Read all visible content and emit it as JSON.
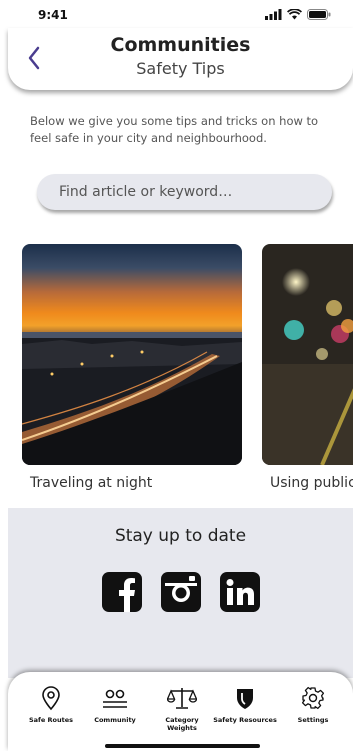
{
  "status": {
    "time": "9:41"
  },
  "header": {
    "title": "Communities",
    "subtitle": "Safety Tips"
  },
  "intro": "Below we give you some tips and tricks on how to feel safe in your city and neighbourhood.",
  "search": {
    "placeholder": "Find article or keyword…"
  },
  "articles": [
    {
      "label": "Traveling at night"
    },
    {
      "label": "Using public"
    }
  ],
  "social": {
    "title": "Stay up to date",
    "icons": [
      "facebook-icon",
      "instagram-icon",
      "linkedin-icon"
    ]
  },
  "nav": {
    "items": [
      {
        "label": "Safe Routes",
        "icon": "location-pin-icon"
      },
      {
        "label": "Community",
        "icon": "people-icon"
      },
      {
        "label": "Category Weights",
        "icon": "scale-icon"
      },
      {
        "label": "Safety Resources",
        "icon": "shield-icon"
      },
      {
        "label": "Settings",
        "icon": "gear-icon"
      }
    ]
  },
  "colors": {
    "accent": "#4a3d8f",
    "panel": "#e7e8ee"
  }
}
